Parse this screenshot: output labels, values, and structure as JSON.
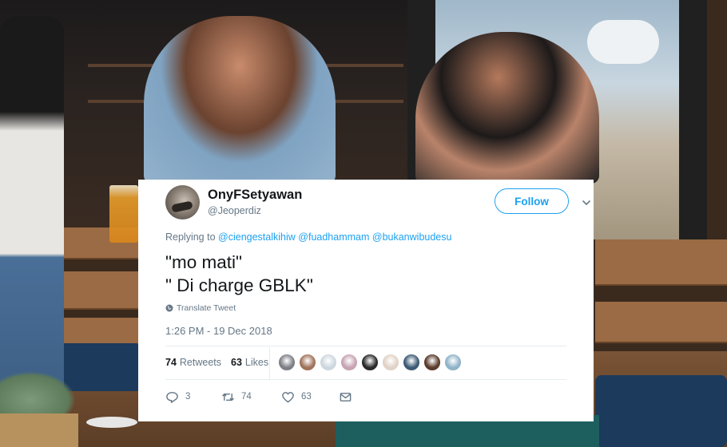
{
  "tweet": {
    "display_name": "OnyFSetyawan",
    "handle": "@Jeoperdiz",
    "follow_label": "Follow",
    "replying_prefix": "Replying to",
    "mentions": [
      "@ciengestalkihiw",
      "@fuadhammam",
      "@bukanwibudesu"
    ],
    "text_line1": "\"mo mati\"",
    "text_line2": "\" Di charge GBLK\"",
    "translate_label": "Translate Tweet",
    "timestamp": "1:26 PM - 19 Dec 2018",
    "retweets_count": "74",
    "retweets_label": "Retweets",
    "likes_count": "63",
    "likes_label": "Likes",
    "liker_avatar_colors": [
      "#7d7f86",
      "#a0735a",
      "#cdd7df",
      "#c7a3b3",
      "#2a2a2a",
      "#e0d2c6",
      "#3c5a75",
      "#5a3b2b",
      "#8fb3c8"
    ],
    "actions": {
      "reply_count": "3",
      "retweet_count": "74",
      "like_count": "63"
    },
    "colors": {
      "accent": "#1da1f2",
      "text": "#14171a",
      "muted": "#657786"
    }
  },
  "icons": {
    "caret": "chevron-down-icon",
    "globe": "globe-icon",
    "reply": "reply-icon",
    "retweet": "retweet-icon",
    "like": "heart-icon",
    "share": "envelope-icon"
  }
}
